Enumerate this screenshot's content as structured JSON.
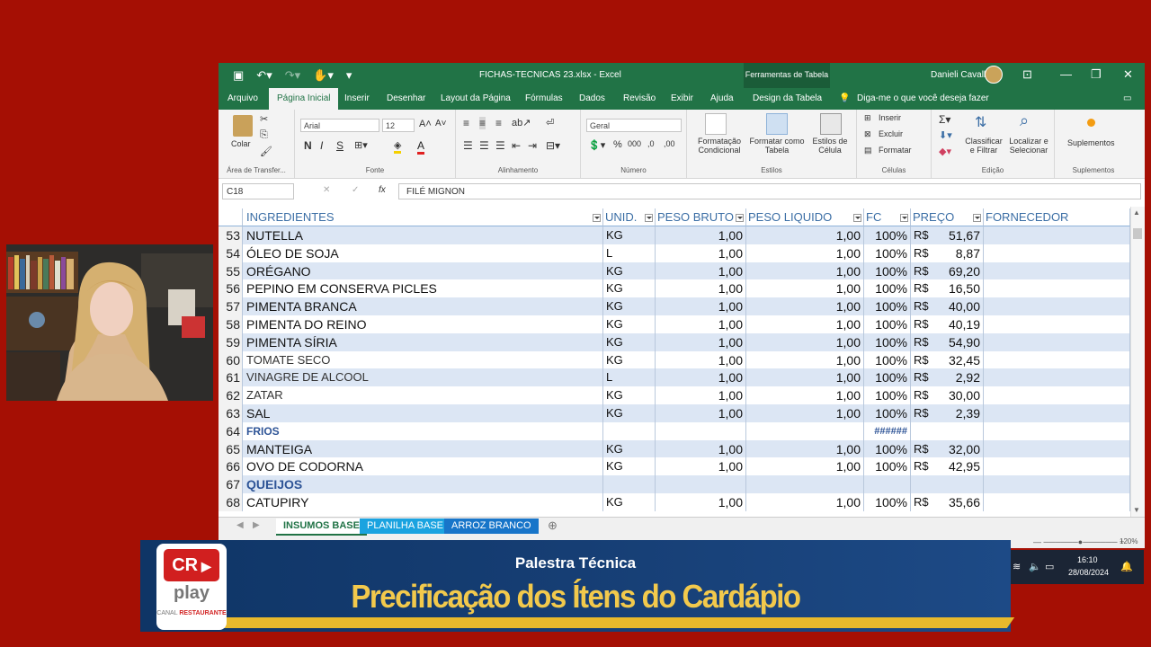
{
  "app": {
    "window_title": "FICHAS-TECNICAS 23.xlsx  -  Excel",
    "context_tab": "Ferramentas de Tabela",
    "user": "Danieli Cavalli",
    "menu": [
      "Arquivo",
      "Página Inicial",
      "Inserir",
      "Desenhar",
      "Layout da Página",
      "Fórmulas",
      "Dados",
      "Revisão",
      "Exibir",
      "Ajuda",
      "Design da Tabela"
    ],
    "tell_me": "Diga-me o que você deseja fazer"
  },
  "ribbon": {
    "paste": "Colar",
    "clipboard": "Área de Transfer...",
    "font_name": "Arial",
    "font_size": "12",
    "bold": "N",
    "italic": "I",
    "underline": "S",
    "font_group": "Fonte",
    "align_group": "Alinhamento",
    "number_format": "Geral",
    "number_group": "Número",
    "cond_format": "Formatação Condicional",
    "format_table": "Formatar como Tabela",
    "cell_styles": "Estilos de Célula",
    "styles_group": "Estilos",
    "insert": "Inserir",
    "delete": "Excluir",
    "format": "Formatar",
    "cells_group": "Células",
    "sort_filter": "Classificar e Filtrar",
    "find_select": "Localizar e Selecionar",
    "editing_group": "Edição",
    "addins": "Suplementos",
    "addins_group": "Suplementos"
  },
  "formula": {
    "cell_ref": "C18",
    "fx": "fx",
    "value": "FILÉ MIGNON"
  },
  "table": {
    "headers": [
      "INGREDIENTES",
      "UNID.",
      "PESO BRUTO",
      "PESO LIQUIDO",
      "FC",
      "PREÇO",
      "FORNECEDOR"
    ],
    "rows": [
      {
        "n": "53",
        "name": "NUTELLA",
        "unit": "KG",
        "bruto": "1,00",
        "liq": "1,00",
        "fc": "100%",
        "cur": "R$",
        "price": "51,67"
      },
      {
        "n": "54",
        "name": "ÓLEO DE SOJA",
        "unit": "L",
        "bruto": "1,00",
        "liq": "1,00",
        "fc": "100%",
        "cur": "R$",
        "price": "8,87"
      },
      {
        "n": "55",
        "name": "ORÉGANO",
        "unit": "KG",
        "bruto": "1,00",
        "liq": "1,00",
        "fc": "100%",
        "cur": "R$",
        "price": "69,20"
      },
      {
        "n": "56",
        "name": "PEPINO EM CONSERVA PICLES",
        "unit": "KG",
        "bruto": "1,00",
        "liq": "1,00",
        "fc": "100%",
        "cur": "R$",
        "price": "16,50"
      },
      {
        "n": "57",
        "name": "PIMENTA BRANCA",
        "unit": "KG",
        "bruto": "1,00",
        "liq": "1,00",
        "fc": "100%",
        "cur": "R$",
        "price": "40,00"
      },
      {
        "n": "58",
        "name": "PIMENTA DO REINO",
        "unit": "KG",
        "bruto": "1,00",
        "liq": "1,00",
        "fc": "100%",
        "cur": "R$",
        "price": "40,19"
      },
      {
        "n": "59",
        "name": "PIMENTA SÍRIA",
        "unit": "KG",
        "bruto": "1,00",
        "liq": "1,00",
        "fc": "100%",
        "cur": "R$",
        "price": "54,90"
      },
      {
        "n": "60",
        "name": "TOMATE SECO",
        "unit": "KG",
        "bruto": "1,00",
        "liq": "1,00",
        "fc": "100%",
        "cur": "R$",
        "price": "32,45"
      },
      {
        "n": "61",
        "name": "VINAGRE DE ALCOOL",
        "unit": "L",
        "bruto": "1,00",
        "liq": "1,00",
        "fc": "100%",
        "cur": "R$",
        "price": "2,92"
      },
      {
        "n": "62",
        "name": "ZATAR",
        "unit": "KG",
        "bruto": "1,00",
        "liq": "1,00",
        "fc": "100%",
        "cur": "R$",
        "price": "30,00"
      },
      {
        "n": "63",
        "name": "SAL",
        "unit": "KG",
        "bruto": "1,00",
        "liq": "1,00",
        "fc": "100%",
        "cur": "R$",
        "price": "2,39"
      },
      {
        "n": "64",
        "name": "FRIOS",
        "unit": "",
        "bruto": "",
        "liq": "",
        "fc": "######",
        "cur": "",
        "price": "",
        "section": true
      },
      {
        "n": "65",
        "name": "MANTEIGA",
        "unit": "KG",
        "bruto": "1,00",
        "liq": "1,00",
        "fc": "100%",
        "cur": "R$",
        "price": "32,00"
      },
      {
        "n": "66",
        "name": "OVO DE CODORNA",
        "unit": "KG",
        "bruto": "1,00",
        "liq": "1,00",
        "fc": "100%",
        "cur": "R$",
        "price": "42,95"
      },
      {
        "n": "67",
        "name": "QUEIJOS",
        "unit": "",
        "bruto": "",
        "liq": "",
        "fc": "",
        "cur": "",
        "price": "",
        "section": true
      },
      {
        "n": "68",
        "name": "CATUPIRY",
        "unit": "KG",
        "bruto": "1,00",
        "liq": "1,00",
        "fc": "100%",
        "cur": "R$",
        "price": "35,66"
      }
    ]
  },
  "sheets": [
    "INSUMOS BASE",
    "PLANILHA BASE",
    "ARROZ BRANCO"
  ],
  "status": {
    "zoom": "120%"
  },
  "taskbar": {
    "time": "16:10",
    "date": "28/08/2024"
  },
  "banner": {
    "logo_cr": "CR",
    "logo_play": "play",
    "logo_canal": "CANAL",
    "logo_restaurante": "RESTAURANTE",
    "subtitle": "Palestra Técnica",
    "title": "Precificação dos Ítens do Cardápio"
  },
  "colors": {
    "background": "#a50f04",
    "excel_green": "#217346",
    "banner_blue": "#163e74",
    "banner_yellow": "#e8b92c",
    "title_yellow": "#f2c94c"
  }
}
